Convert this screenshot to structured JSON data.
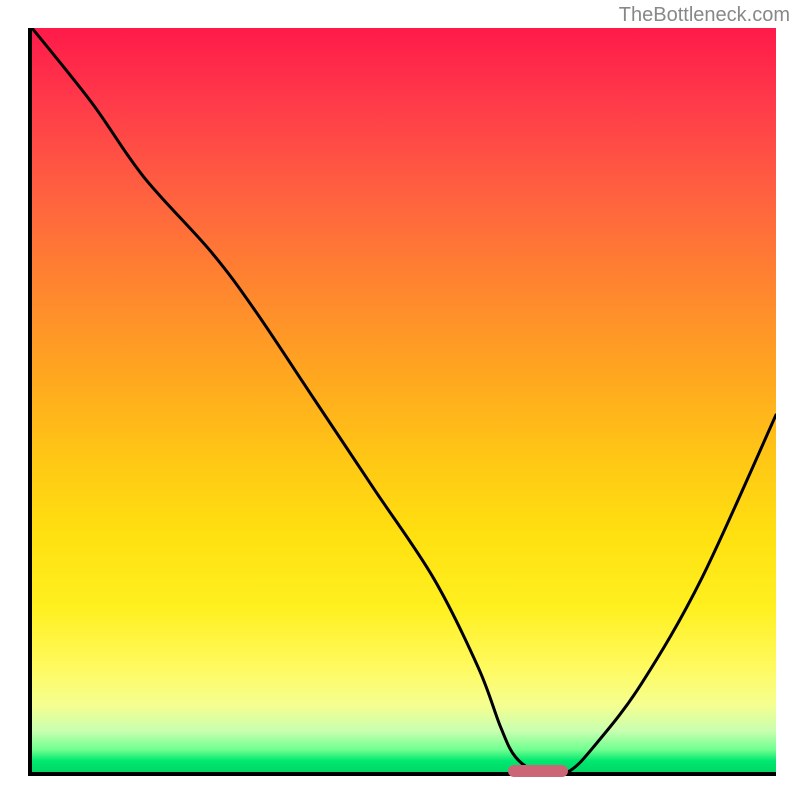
{
  "watermark": "TheBottleneck.com",
  "chart_data": {
    "type": "line",
    "title": "",
    "xlabel": "",
    "ylabel": "",
    "xlim": [
      0,
      100
    ],
    "ylim": [
      0,
      100
    ],
    "series": [
      {
        "name": "bottleneck-curve",
        "x": [
          0,
          8,
          15,
          24,
          30,
          38,
          46,
          54,
          60,
          63,
          65,
          68,
          72,
          76,
          82,
          90,
          100
        ],
        "values": [
          100,
          90,
          80,
          70,
          62,
          50,
          38,
          26,
          14,
          6,
          2,
          0,
          0,
          4,
          12,
          26,
          48
        ]
      }
    ],
    "optimal_range": {
      "x_start": 64,
      "x_end": 72,
      "y": 0
    },
    "colors": {
      "gradient_top": "#ff1a4a",
      "gradient_mid": "#ffe010",
      "gradient_bottom": "#00d865",
      "curve": "#000000",
      "marker": "#cc6677",
      "axis": "#000000"
    }
  }
}
